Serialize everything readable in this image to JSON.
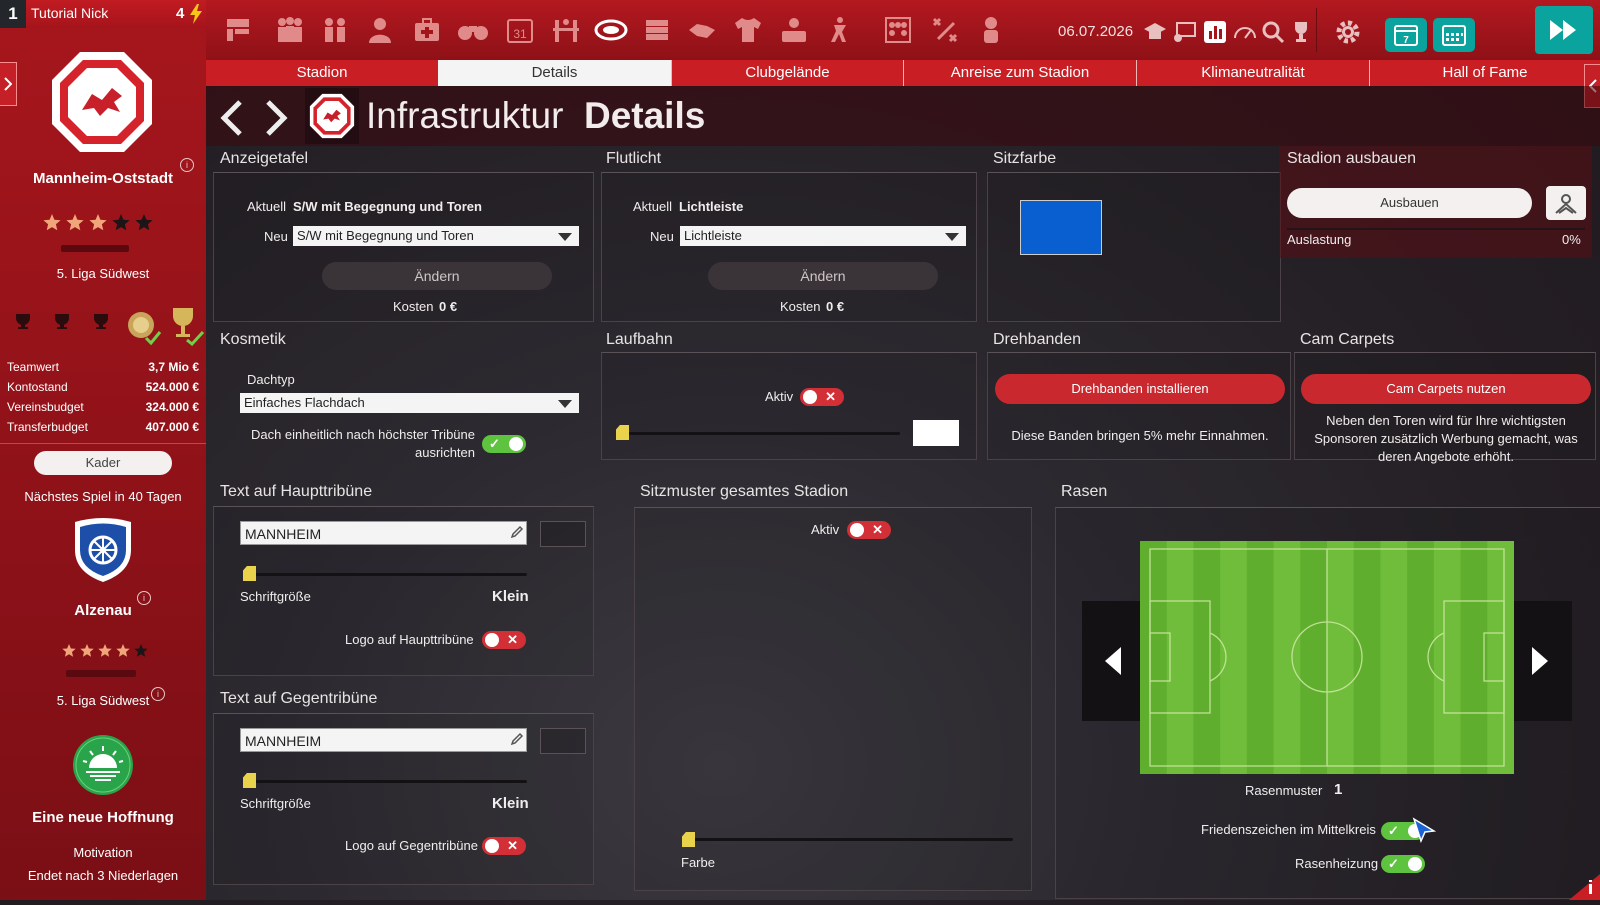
{
  "manager": {
    "rank": "1",
    "name": "Tutorial Nick",
    "count": "4"
  },
  "topbar": {
    "date": "06.07.2026"
  },
  "club": {
    "name": "Mannheim-Oststadt",
    "league": "5. Liga Südwest",
    "stars": 3,
    "stats": [
      {
        "label": "Teamwert",
        "value": "3,7 Mio €"
      },
      {
        "label": "Kontostand",
        "value": "524.000 €"
      },
      {
        "label": "Vereinsbudget",
        "value": "324.000 €"
      },
      {
        "label": "Transferbudget",
        "value": "407.000 €"
      }
    ],
    "kader_label": "Kader",
    "next_match": "Nächstes Spiel in 40 Tagen"
  },
  "opponent": {
    "name": "Alzenau",
    "league": "5. Liga Südwest",
    "stars": 4
  },
  "motivation": {
    "title": "Eine neue Hoffnung",
    "label": "Motivation",
    "ends": "Endet nach 3 Niederlagen"
  },
  "tabs": [
    {
      "label": "Stadion",
      "active": false
    },
    {
      "label": "Details",
      "active": true
    },
    {
      "label": "Clubgelände",
      "active": false
    },
    {
      "label": "Anreise zum Stadion",
      "active": false
    },
    {
      "label": "Klimaneutralität",
      "active": false
    },
    {
      "label": "Hall of Fame",
      "active": false
    }
  ],
  "headline": {
    "part1": "Infrastruktur",
    "part2": "Details"
  },
  "anzeigetafel": {
    "title": "Anzeigetafel",
    "current_label": "Aktuell",
    "current_value": "S/W mit Begegnung und Toren",
    "new_label": "Neu",
    "new_value": "S/W mit Begegnung und Toren",
    "change_label": "Ändern",
    "cost_label": "Kosten",
    "cost_value": "0 €"
  },
  "flutlicht": {
    "title": "Flutlicht",
    "current_label": "Aktuell",
    "current_value": "Lichtleiste",
    "new_label": "Neu",
    "new_value": "Lichtleiste",
    "change_label": "Ändern",
    "cost_label": "Kosten",
    "cost_value": "0 €"
  },
  "sitzfarbe": {
    "title": "Sitzfarbe",
    "color": "#0a5fd0"
  },
  "stadion_ausbauen": {
    "title": "Stadion ausbauen",
    "button_label": "Ausbauen",
    "utilization_label": "Auslastung",
    "utilization_value": "0%"
  },
  "kosmetik": {
    "title": "Kosmetik",
    "roof_label": "Dachtyp",
    "roof_value": "Einfaches Flachdach",
    "align_label": "Dach einheitlich nach höchster Tribüne ausrichten",
    "align_on": true
  },
  "laufbahn": {
    "title": "Laufbahn",
    "active_label": "Aktiv",
    "active_on": false,
    "color": "#ffffff"
  },
  "drehbanden": {
    "title": "Drehbanden",
    "button_label": "Drehbanden installieren",
    "text": "Diese Banden bringen 5% mehr Einnahmen."
  },
  "cam_carpets": {
    "title": "Cam Carpets",
    "button_label": "Cam Carpets nutzen",
    "text": "Neben den Toren wird für Ihre wichtigsten Sponsoren zusätzlich Werbung gemacht, was deren Angebote erhöht."
  },
  "haupttribuene": {
    "title": "Text auf Haupttribüne",
    "text_value": "MANNHEIM",
    "size_label": "Schriftgröße",
    "size_value": "Klein",
    "logo_label": "Logo auf Haupttribüne",
    "logo_on": false
  },
  "gegentribuene": {
    "title": "Text auf Gegentribüne",
    "text_value": "MANNHEIM",
    "size_label": "Schriftgröße",
    "size_value": "Klein",
    "logo_label": "Logo auf Gegentribüne",
    "logo_on": false
  },
  "sitzmuster": {
    "title": "Sitzmuster gesamtes Stadion",
    "active_label": "Aktiv",
    "active_on": false,
    "color_label": "Farbe"
  },
  "rasen": {
    "title": "Rasen",
    "pattern_label": "Rasenmuster",
    "pattern_value": "1",
    "peace_label": "Friedenszeichen im Mittelkreis",
    "peace_on": true,
    "heating_label": "Rasenheizung",
    "heating_on": true
  },
  "colors": {
    "accent": "#c81e24",
    "teal": "#0aa39d",
    "toggle_on": "#5ec33f",
    "toggle_off": "#d32f36"
  }
}
